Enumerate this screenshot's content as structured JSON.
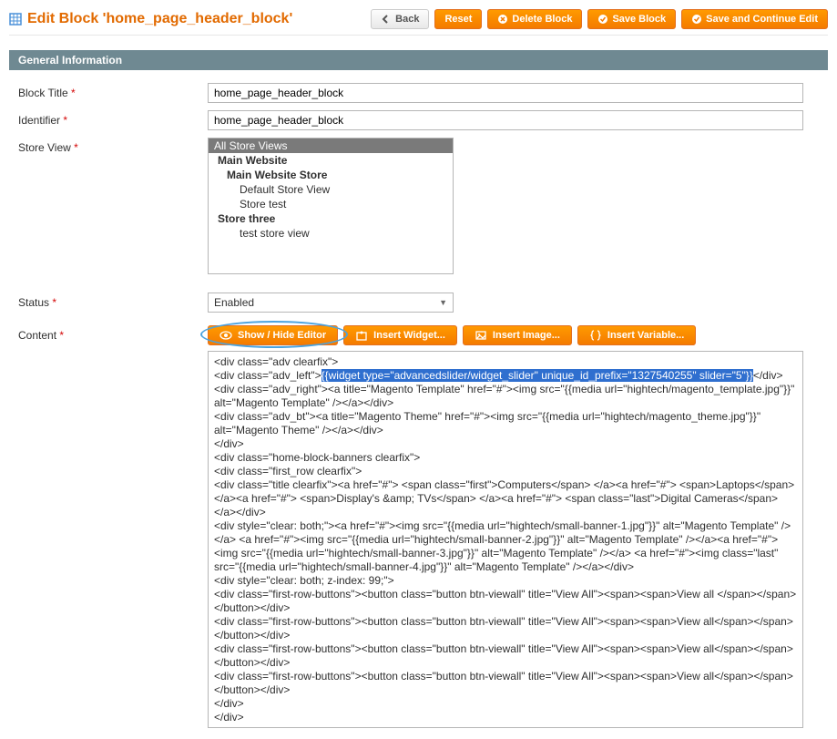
{
  "page": {
    "title": "Edit Block 'home_page_header_block'"
  },
  "header_buttons": {
    "back": "Back",
    "reset": "Reset",
    "delete": "Delete Block",
    "save": "Save Block",
    "save_continue": "Save and Continue Edit"
  },
  "section": {
    "title": "General Information"
  },
  "fields": {
    "block_title": {
      "label": "Block Title",
      "value": "home_page_header_block"
    },
    "identifier": {
      "label": "Identifier",
      "value": "home_page_header_block"
    },
    "store_view": {
      "label": "Store View",
      "options": {
        "all": "All Store Views",
        "main_website": "Main Website",
        "main_website_store": "Main Website Store",
        "default_sv": "Default Store View",
        "store_test": "Store test",
        "store_three": "Store three",
        "test_sv": "test store view"
      }
    },
    "status": {
      "label": "Status",
      "value": "Enabled"
    },
    "content": {
      "label": "Content",
      "buttons": {
        "show_hide": "Show / Hide Editor",
        "insert_widget": "Insert Widget...",
        "insert_image": "Insert Image...",
        "insert_variable": "Insert Variable..."
      },
      "code_pre": "<div class=\"adv clearfix\">\n<div class=\"adv_left\">",
      "code_hl": "{{widget type=\"advancedslider/widget_slider\" unique_id_prefix=\"1327540255\" slider=\"5\"}}",
      "code_post": "</div>\n<div class=\"adv_right\"><a title=\"Magento Template\" href=\"#\"><img src=\"{{media url=\"hightech/magento_template.jpg\"}}\" alt=\"Magento Template\" /></a></div>\n<div class=\"adv_bt\"><a title=\"Magento Theme\" href=\"#\"><img src=\"{{media url=\"hightech/magento_theme.jpg\"}}\" alt=\"Magento Theme\" /></a></div>\n</div>\n<div class=\"home-block-banners clearfix\">\n<div class=\"first_row clearfix\">\n<div class=\"title clearfix\"><a href=\"#\"> <span class=\"first\">Computers</span> </a><a href=\"#\"> <span>Laptops</span> </a><a href=\"#\"> <span>Display's &amp; TVs</span> </a><a href=\"#\"> <span class=\"last\">Digital Cameras</span> </a></div>\n<div style=\"clear: both;\"><a href=\"#\"><img src=\"{{media url=\"hightech/small-banner-1.jpg\"}}\" alt=\"Magento Template\" /></a> <a href=\"#\"><img src=\"{{media url=\"hightech/small-banner-2.jpg\"}}\" alt=\"Magento Template\" /></a><a href=\"#\"> <img src=\"{{media url=\"hightech/small-banner-3.jpg\"}}\" alt=\"Magento Template\" /></a> <a href=\"#\"><img class=\"last\" src=\"{{media url=\"hightech/small-banner-4.jpg\"}}\" alt=\"Magento Template\" /></a></div>\n<div style=\"clear: both; z-index: 99;\">\n<div class=\"first-row-buttons\"><button class=\"button btn-viewall\" title=\"View All\"><span><span>View all </span></span></button></div>\n<div class=\"first-row-buttons\"><button class=\"button btn-viewall\" title=\"View All\"><span><span>View all</span></span></button></div>\n<div class=\"first-row-buttons\"><button class=\"button btn-viewall\" title=\"View All\"><span><span>View all</span></span></button></div>\n<div class=\"first-row-buttons\"><button class=\"button btn-viewall\" title=\"View All\"><span><span>View all</span></span></button></div>\n</div>\n</div>"
    }
  }
}
